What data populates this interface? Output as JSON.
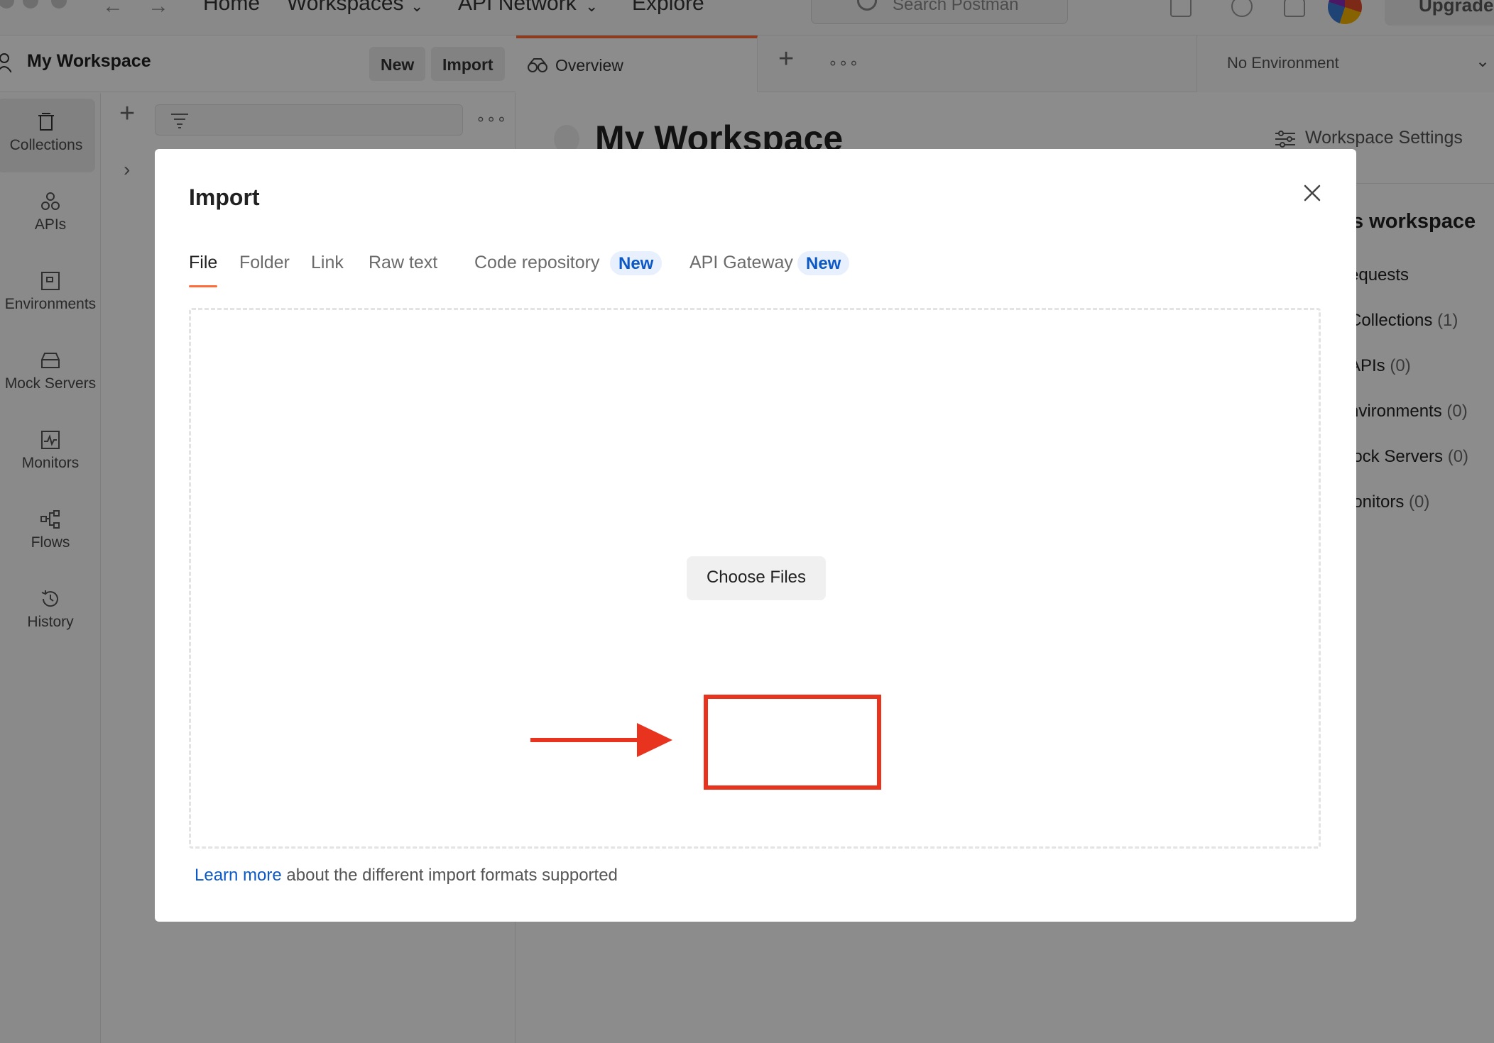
{
  "topbar": {
    "nav": [
      "Home",
      "Workspaces",
      "API Network",
      "Explore"
    ],
    "search_placeholder": "Search Postman",
    "upgrade_label": "Upgrade"
  },
  "workspace_header": {
    "title": "My Workspace",
    "new_label": "New",
    "import_label": "Import"
  },
  "sidebar": {
    "items": [
      {
        "label": "Collections",
        "icon": "collections-icon"
      },
      {
        "label": "APIs",
        "icon": "apis-icon"
      },
      {
        "label": "Environments",
        "icon": "environments-icon"
      },
      {
        "label": "Mock Servers",
        "icon": "mock-servers-icon"
      },
      {
        "label": "Monitors",
        "icon": "monitors-icon"
      },
      {
        "label": "Flows",
        "icon": "flows-icon"
      },
      {
        "label": "History",
        "icon": "history-icon"
      }
    ]
  },
  "tabbar": {
    "overview_label": "Overview",
    "environment_label": "No Environment"
  },
  "main": {
    "title": "My Workspace",
    "settings_label": "Workspace Settings",
    "right_panel": {
      "heading": "s workspace",
      "items": [
        {
          "label": "equests",
          "count": ""
        },
        {
          "label": "Collections",
          "count": "(1)"
        },
        {
          "label": "APIs",
          "count": "(0)"
        },
        {
          "label": "nvironments",
          "count": "(0)"
        },
        {
          "label": "lock Servers",
          "count": "(0)"
        },
        {
          "label": "lonitors",
          "count": "(0)"
        }
      ]
    }
  },
  "modal": {
    "title": "Import",
    "tabs": [
      {
        "label": "File",
        "badge": ""
      },
      {
        "label": "Folder",
        "badge": ""
      },
      {
        "label": "Link",
        "badge": ""
      },
      {
        "label": "Raw text",
        "badge": ""
      },
      {
        "label": "Code repository",
        "badge": "New"
      },
      {
        "label": "API Gateway",
        "badge": "New"
      }
    ],
    "choose_files_label": "Choose Files",
    "footer_link": "Learn more",
    "footer_text": " about the different import formats supported"
  },
  "colors": {
    "accent": "#ff6c37",
    "highlight": "#e8341f",
    "badge_text": "#0c59c6",
    "badge_bg": "#e7f0fc"
  }
}
